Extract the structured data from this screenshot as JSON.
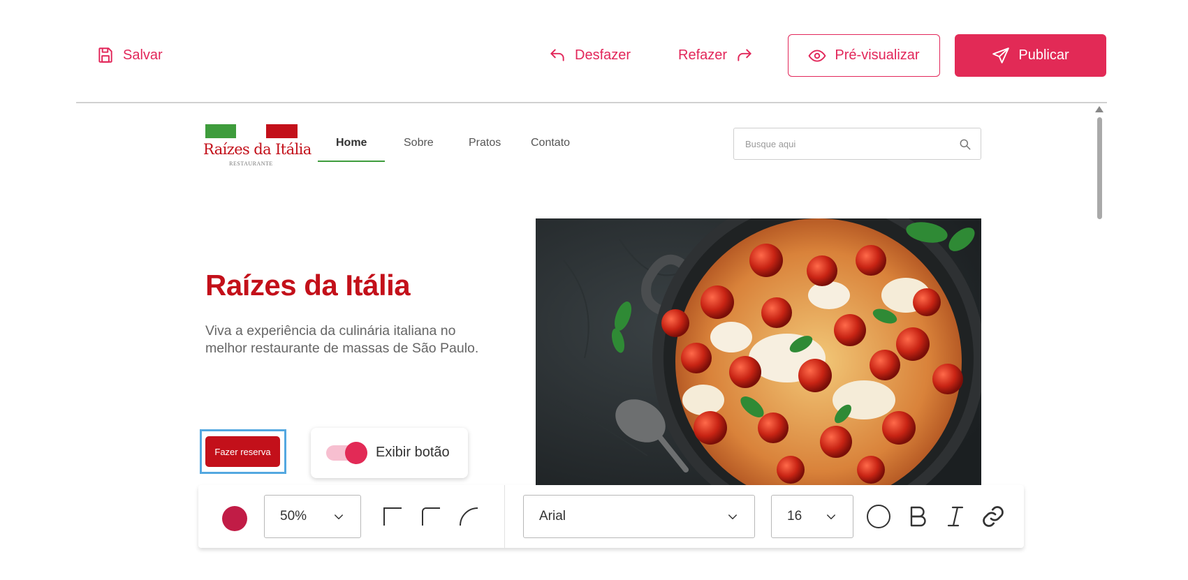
{
  "toolbar": {
    "save_label": "Salvar",
    "undo_label": "Desfazer",
    "redo_label": "Refazer",
    "preview_label": "Pré-visualizar",
    "publish_label": "Publicar"
  },
  "site": {
    "logo_title": "Raízes da Itália",
    "logo_subtitle": "RESTAURANTE",
    "nav": [
      "Home",
      "Sobre",
      "Pratos",
      "Contato"
    ],
    "active_nav": "Home",
    "search_placeholder": "Busque aqui",
    "hero_title": "Raízes da Itália",
    "hero_text": "Viva a experiência da culinária italiana no melhor restaurante de massas de São Paulo.",
    "cta_label": "Fazer reserva",
    "toggle_label": "Exibir botão",
    "toggle_on": true,
    "hero_image_icon": "pasta-skillet-image"
  },
  "format": {
    "color": "#c11c46",
    "opacity": "50%",
    "font": "Arial",
    "size": "16",
    "corner_icons": [
      "square-corner-icon",
      "small-radius-corner-icon",
      "round-corner-icon"
    ],
    "style_icons": [
      "circle-icon",
      "bold-icon",
      "italic-icon",
      "link-icon"
    ]
  },
  "colors": {
    "accent": "#e22a56",
    "brand_red": "#c3101a",
    "brand_green": "#3e9c3c",
    "selection": "#54a8e0"
  }
}
